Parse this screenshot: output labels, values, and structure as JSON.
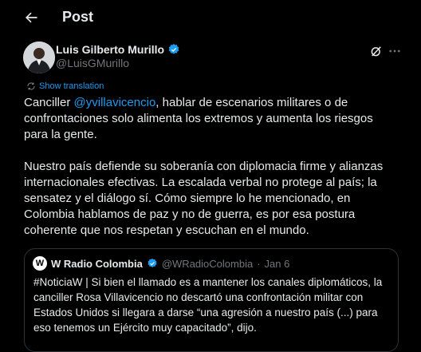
{
  "header": {
    "title": "Post"
  },
  "author": {
    "name": "Luis Gilberto Murillo",
    "handle": "@LuisGMurillo",
    "verified_color": "#1d9bf0"
  },
  "icons": {
    "back": "arrow-left-icon",
    "verified": "verified-badge-icon",
    "grok": "grok-icon",
    "more": "more-horizontal-icon",
    "translate": "translate-icon"
  },
  "translate_label": "Show translation",
  "tweet": {
    "p1_before": "Canciller ",
    "p1_mention": "@yvillavicencio",
    "p1_after": ", hablar de escenarios militares o de confrontaciones solo alimenta los extremos y aumenta los riesgos para la gente.",
    "p2": "Nuestro país defiende su soberanía con diplomacia firme y alianzas internacionales efectivas. La escalada verbal no protege al país; la sensatez y el diálogo sí. Cómo siempre lo he mencionado, en Colombia hablamos de paz y no de guerra, es por esa postura coherente que nos respetan y escuchan en el mundo."
  },
  "quote": {
    "name": "W Radio Colombia",
    "handle": "@WRadioColombia",
    "separator": "·",
    "date": "Jan 6",
    "logo_letter": "W",
    "text": "#NoticiaW | Si bien el llamado es a mantener los canales diplomáticos, la canciller Rosa Villavicencio no descartó una confrontación militar con Estados Unidos si llegara a darse “una agresión a nuestro país (...) para eso tenemos un Ejército muy capacitado”, dijo."
  },
  "colors": {
    "background": "#000000",
    "text": "#e7e9ea",
    "secondary": "#71767b",
    "accent": "#1d9bf0",
    "border": "#2f3336"
  }
}
